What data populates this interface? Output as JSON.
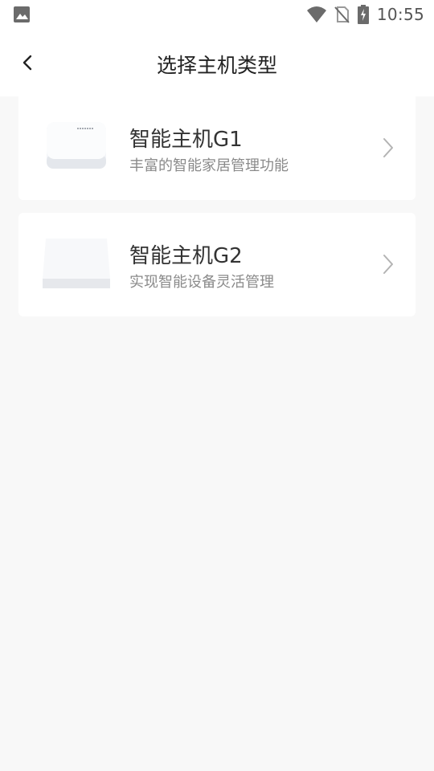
{
  "status_bar": {
    "time": "10:55",
    "icons": [
      "gallery-icon",
      "wifi-icon",
      "no-sim-icon",
      "battery-charging-icon"
    ]
  },
  "app_bar": {
    "back_icon": "chevron-left-icon",
    "title": "选择主机类型"
  },
  "devices": [
    {
      "name": "智能主机G1",
      "description": "丰富的智能家居管理功能",
      "icon": "hub-g1-image"
    },
    {
      "name": "智能主机G2",
      "description": "实现智能设备灵活管理",
      "icon": "hub-g2-image"
    }
  ],
  "colors": {
    "background": "#f8f8f8",
    "card": "#ffffff",
    "title_text": "#333333",
    "subtitle_text": "#8a8a8a"
  }
}
